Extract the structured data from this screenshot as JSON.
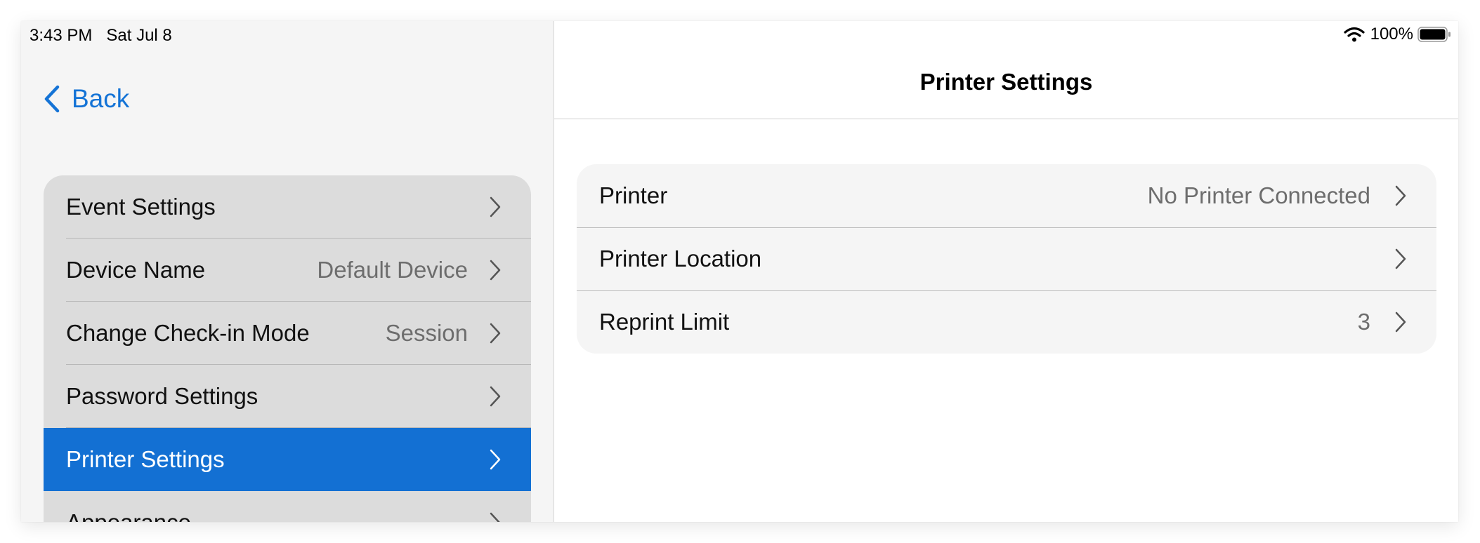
{
  "status": {
    "time": "3:43 PM",
    "date": "Sat Jul 8",
    "battery": "100%"
  },
  "sidebar": {
    "back_label": "Back",
    "items": [
      {
        "label": "Event Settings",
        "value": ""
      },
      {
        "label": "Device Name",
        "value": "Default Device"
      },
      {
        "label": "Change Check-in Mode",
        "value": "Session"
      },
      {
        "label": "Password Settings",
        "value": ""
      },
      {
        "label": "Printer Settings",
        "value": ""
      },
      {
        "label": "Appearance",
        "value": ""
      }
    ]
  },
  "detail": {
    "title": "Printer Settings",
    "rows": [
      {
        "label": "Printer",
        "value": "No Printer Connected"
      },
      {
        "label": "Printer Location",
        "value": ""
      },
      {
        "label": "Reprint Limit",
        "value": "3"
      }
    ]
  },
  "colors": {
    "accent": "#1370d3",
    "link": "#1473d6",
    "sidebar_bg": "#f5f5f5",
    "menu_bg": "#dcdcdc"
  }
}
